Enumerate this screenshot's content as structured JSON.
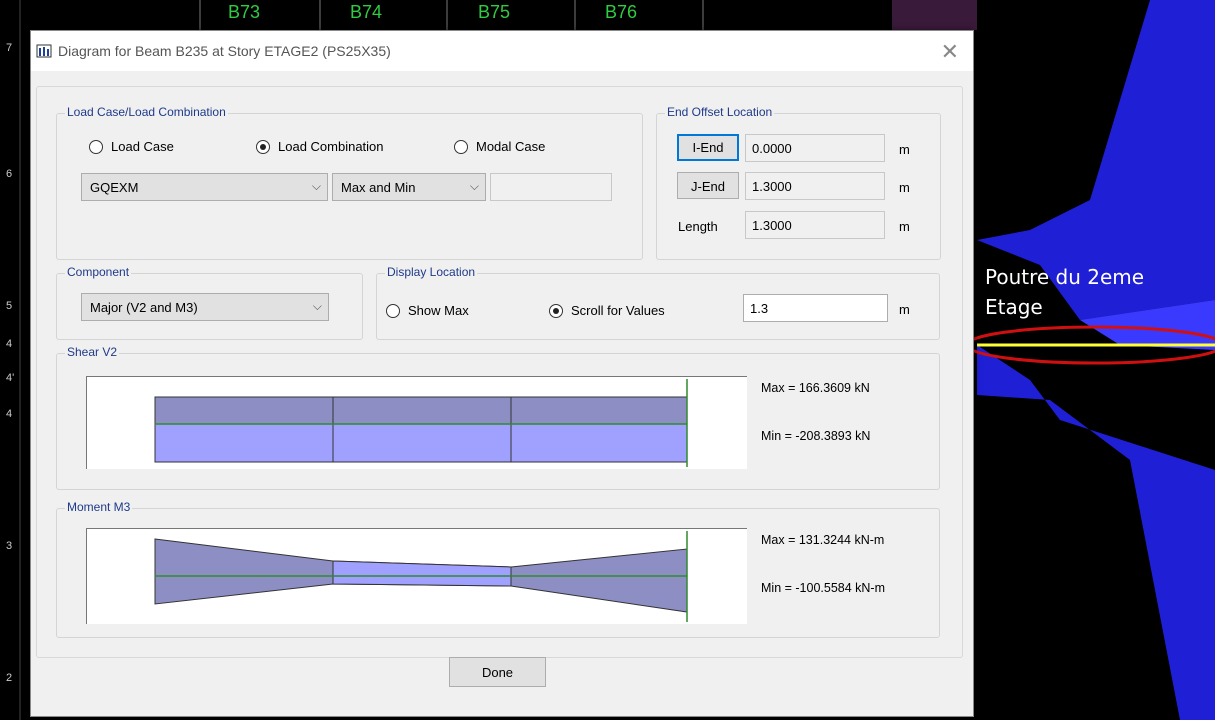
{
  "background": {
    "beam_labels": [
      "B73",
      "B74",
      "B75",
      "B76"
    ],
    "ruler_numbers": [
      "7",
      "6",
      "5",
      "4",
      "4'",
      "4",
      "3",
      "2"
    ],
    "annotation": [
      "Poutre du 2eme",
      "Etage"
    ]
  },
  "dialog": {
    "title": "Diagram for Beam B235 at Story ETAGE2 (PS25X35)",
    "close_icon": "close-icon",
    "load_group": {
      "title": "Load Case/Load Combination",
      "radios": [
        {
          "label": "Load Case",
          "selected": false
        },
        {
          "label": "Load Combination",
          "selected": true
        },
        {
          "label": "Modal Case",
          "selected": false
        }
      ],
      "combo_value": "GQEXM",
      "maxmin_value": "Max and Min",
      "extra_value": ""
    },
    "end_offset": {
      "title": "End Offset Location",
      "i_end_label": "I-End",
      "i_end_value": "0.0000",
      "j_end_label": "J-End",
      "j_end_value": "1.3000",
      "length_label": "Length",
      "length_value": "1.3000",
      "unit": "m"
    },
    "component": {
      "title": "Component",
      "value": "Major (V2 and M3)"
    },
    "display_location": {
      "title": "Display Location",
      "show_max": "Show Max",
      "show_max_selected": false,
      "scroll": "Scroll for Values",
      "scroll_selected": true,
      "value": "1.3",
      "unit": "m"
    },
    "shear": {
      "title": "Shear V2",
      "max": "Max = 166.3609 kN",
      "min": "Min = -208.3893 kN"
    },
    "moment": {
      "title": "Moment M3",
      "max": "Max = 131.3244 kN-m",
      "min": "Min = -100.5584 kN-m"
    },
    "done_label": "Done"
  },
  "colors": {
    "fill_light": "#a0a0ff",
    "fill_dark": "#8d8fc4",
    "axis_green": "#2e8b2e",
    "group_title": "#1e3a8a"
  }
}
